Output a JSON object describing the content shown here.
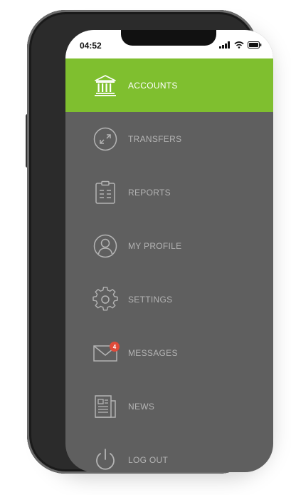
{
  "status_bar": {
    "time": "04:52"
  },
  "menu": {
    "items": [
      {
        "label": "ACCOUNTS",
        "icon": "bank-icon",
        "active": true
      },
      {
        "label": "TRANSFERS",
        "icon": "transfer-arrows-icon"
      },
      {
        "label": "REPORTS",
        "icon": "clipboard-icon"
      },
      {
        "label": "MY PROFILE",
        "icon": "user-icon"
      },
      {
        "label": "SETTINGS",
        "icon": "gear-icon"
      },
      {
        "label": "MESSAGES",
        "icon": "envelope-icon",
        "badge": "4"
      },
      {
        "label": "NEWS",
        "icon": "newspaper-icon"
      },
      {
        "label": "LOG OUT",
        "icon": "power-icon"
      }
    ]
  },
  "colors": {
    "accent": "#7fbf2f",
    "menu_bg": "#5f5f5f",
    "badge": "#e04b3a"
  }
}
